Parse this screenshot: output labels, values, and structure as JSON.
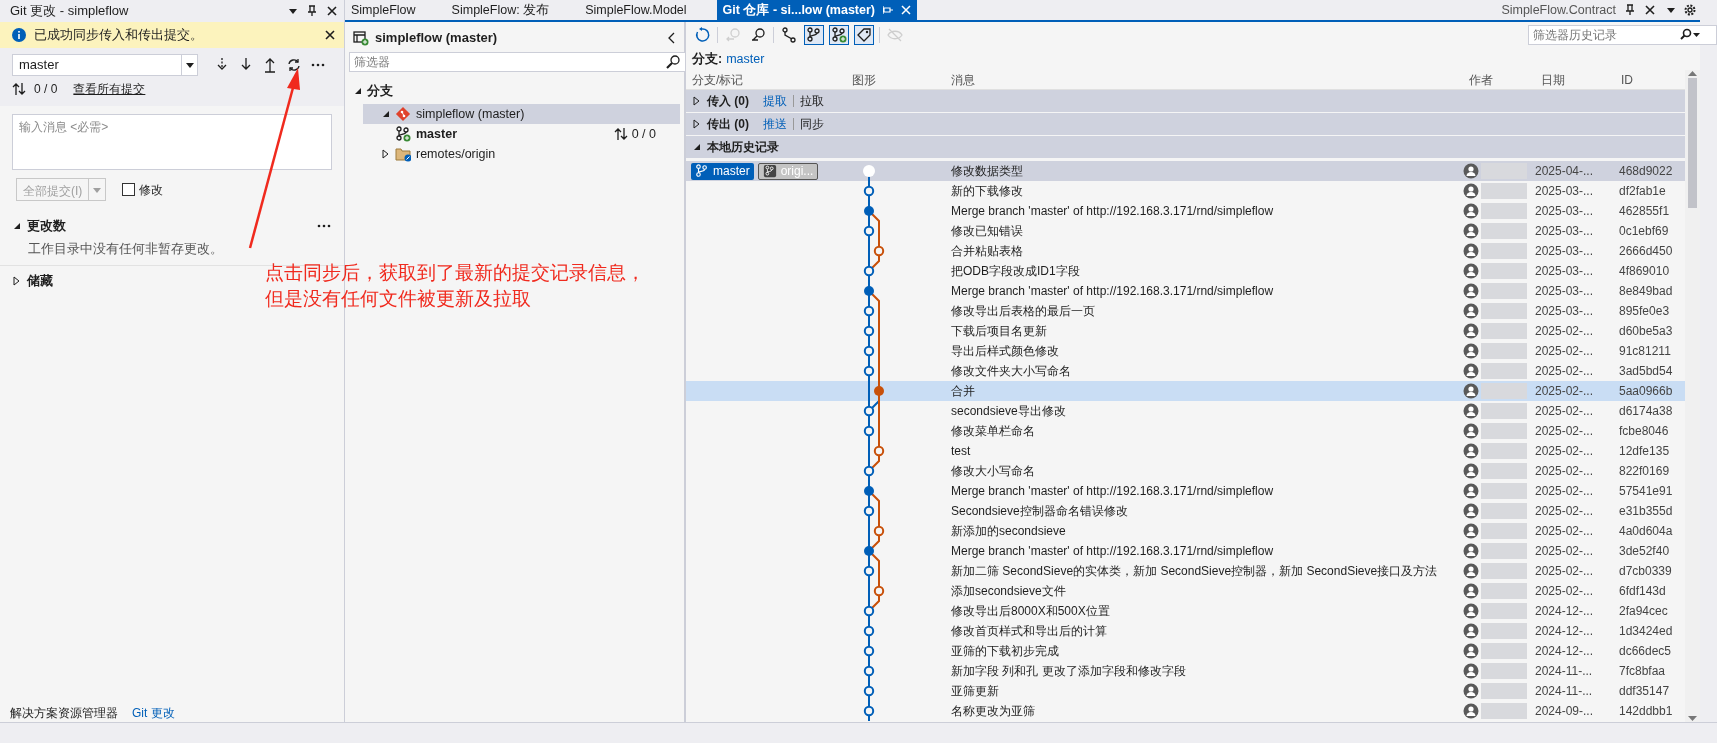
{
  "git_changes_panel": {
    "title": "Git 更改 - simpleflow",
    "notification": {
      "text": "已成功同步传入和传出提交。"
    },
    "branch_combo": {
      "value": "master"
    },
    "sync_status": "0 / 0",
    "view_all_link": "查看所有提交",
    "message_box": {
      "placeholder": "输入消息 <必需>"
    },
    "commit_button": {
      "label": "全部提交(I)",
      "disabled": true
    },
    "amend_checkbox": {
      "label": "修改",
      "checked": false
    },
    "sections": [
      {
        "title": "更改数",
        "expanded": true,
        "text": "工作目录中没有任何非暂存更改。"
      },
      {
        "title": "储藏",
        "expanded": false
      }
    ]
  },
  "bottom_tabs": [
    {
      "label": "解决方案资源管理器",
      "selected": false
    },
    {
      "label": "Git 更改",
      "selected": true
    }
  ],
  "document_tabs": [
    {
      "label": "SimpleFlow",
      "selected": false
    },
    {
      "label": "SimpleFlow: 发布",
      "selected": false
    },
    {
      "label": "SimpleFlow.Model",
      "selected": false
    },
    {
      "label": "Git 仓库 - si...low (master)",
      "selected": true
    }
  ],
  "pinned_tab": {
    "label": "SimpleFlow.Contract"
  },
  "branches_panel": {
    "title": "simpleflow (master)",
    "filter": {
      "placeholder": "筛选器"
    },
    "tree": [
      {
        "label": "分支",
        "kind": "group",
        "expanded": true,
        "selected": false,
        "children": [
          {
            "label": "simpleflow (master)",
            "kind": "repo",
            "expanded": true,
            "selected": true,
            "children": [
              {
                "label": "master",
                "kind": "branch",
                "selected": false,
                "status": "0 / 0"
              }
            ]
          },
          {
            "label": "remotes/origin",
            "kind": "remote",
            "expanded": false,
            "selected": false
          }
        ]
      }
    ]
  },
  "history_panel": {
    "filter": {
      "placeholder": "筛选器历史记录"
    },
    "toolbar": [
      {
        "kind": "refresh",
        "disabled": false,
        "on": false
      },
      {
        "kind": "compare",
        "disabled": true,
        "on": false
      },
      {
        "kind": "search-commit",
        "disabled": false,
        "on": false
      },
      {
        "kind": "graph",
        "disabled": false,
        "on": false
      },
      {
        "kind": "local-branches",
        "disabled": false,
        "on": true
      },
      {
        "kind": "remote-branches",
        "disabled": false,
        "on": true
      },
      {
        "kind": "tags",
        "disabled": false,
        "on": true
      },
      {
        "kind": "hide",
        "disabled": true,
        "on": false
      }
    ],
    "branch_label": "分支:",
    "branch": "master",
    "columns": [
      "分支/标记",
      "图形",
      "消息",
      "作者",
      "日期",
      "ID"
    ],
    "groups": [
      {
        "label": "传入 (0)",
        "expanded": false,
        "links": [
          "提取",
          "拉取"
        ]
      },
      {
        "label": "传出 (0)",
        "expanded": false,
        "links": [
          "推送",
          "同步"
        ]
      },
      {
        "label": "本地历史记录",
        "expanded": true
      }
    ],
    "commits": [
      {
        "refs": [
          {
            "label": "master",
            "kind": "local"
          },
          {
            "label": "origi...",
            "kind": "remote"
          }
        ],
        "side": false,
        "kind": "head",
        "message": "修改数据类型",
        "date": "2025-04-...",
        "id": "468d9022",
        "selected": false,
        "current": true
      },
      {
        "side": false,
        "kind": "commit",
        "message": "新的下载修改",
        "date": "2025-03-...",
        "id": "df2fab1e",
        "selected": false,
        "current": false
      },
      {
        "side": false,
        "kind": "merge",
        "message": "Merge branch 'master' of http://192.168.3.171/rnd/simpleflow",
        "date": "2025-03-...",
        "id": "462855f1",
        "selected": false,
        "current": false
      },
      {
        "side": false,
        "kind": "commit",
        "message": "修改已知错误",
        "date": "2025-03-...",
        "id": "0c1ebf69",
        "selected": false,
        "current": false
      },
      {
        "side": true,
        "kind": "commit",
        "message": "合并粘贴表格",
        "date": "2025-03-...",
        "id": "2666d450",
        "selected": false,
        "current": false
      },
      {
        "side": false,
        "kind": "commit",
        "message": "把ODB字段改成ID1字段",
        "date": "2025-03-...",
        "id": "4f869010",
        "selected": false,
        "current": false
      },
      {
        "side": false,
        "kind": "merge",
        "message": "Merge branch 'master' of http://192.168.3.171/rnd/simpleflow",
        "date": "2025-03-...",
        "id": "8e849bad",
        "selected": false,
        "current": false
      },
      {
        "side": false,
        "kind": "commit",
        "message": "修改导出后表格的最后一页",
        "date": "2025-03-...",
        "id": "895fe0e3",
        "selected": false,
        "current": false
      },
      {
        "side": false,
        "kind": "commit",
        "message": "下载后项目名更新",
        "date": "2025-02-...",
        "id": "d60be5a3",
        "selected": false,
        "current": false
      },
      {
        "side": false,
        "kind": "commit",
        "message": "导出后样式颜色修改",
        "date": "2025-02-...",
        "id": "91c81211",
        "selected": false,
        "current": false
      },
      {
        "side": false,
        "kind": "commit",
        "message": "修改文件夹大小写命名",
        "date": "2025-02-...",
        "id": "3ad5bd54",
        "selected": false,
        "current": false
      },
      {
        "side": true,
        "kind": "merge",
        "message": "合并",
        "date": "2025-02-...",
        "id": "5aa0966b",
        "selected": true,
        "current": false
      },
      {
        "side": false,
        "kind": "commit",
        "message": "secondsieve导出修改",
        "date": "2025-02-...",
        "id": "d6174a38",
        "selected": false,
        "current": false
      },
      {
        "side": false,
        "kind": "commit",
        "message": "修改菜单栏命名",
        "date": "2025-02-...",
        "id": "fcbe8046",
        "selected": false,
        "current": false
      },
      {
        "side": true,
        "kind": "commit",
        "message": "test",
        "date": "2025-02-...",
        "id": "12dfe135",
        "selected": false,
        "current": false
      },
      {
        "side": false,
        "kind": "commit",
        "message": "修改大小写命名",
        "date": "2025-02-...",
        "id": "822f0169",
        "selected": false,
        "current": false
      },
      {
        "side": false,
        "kind": "merge",
        "message": "Merge branch 'master' of http://192.168.3.171/rnd/simpleflow",
        "date": "2025-02-...",
        "id": "57541e91",
        "selected": false,
        "current": false
      },
      {
        "side": false,
        "kind": "commit",
        "message": "Secondsieve控制器命名错误修改",
        "date": "2025-02-...",
        "id": "e31b355d",
        "selected": false,
        "current": false
      },
      {
        "side": true,
        "kind": "commit",
        "message": "新添加的secondsieve",
        "date": "2025-02-...",
        "id": "4a0d604a",
        "selected": false,
        "current": false
      },
      {
        "side": false,
        "kind": "merge",
        "message": "Merge branch 'master' of http://192.168.3.171/rnd/simpleflow",
        "date": "2025-02-...",
        "id": "3de52f40",
        "selected": false,
        "current": false
      },
      {
        "side": false,
        "kind": "commit",
        "message": "新加二筛 SecondSieve的实体类，新加 SecondSieve控制器，新加 SecondSieve接口及方法",
        "date": "2025-02-...",
        "id": "d7cb0339",
        "selected": false,
        "current": false
      },
      {
        "side": true,
        "kind": "commit",
        "message": "添加secondsieve文件",
        "date": "2025-02-...",
        "id": "6fdf143d",
        "selected": false,
        "current": false
      },
      {
        "side": false,
        "kind": "commit",
        "message": "修改导出后8000X和500X位置",
        "date": "2024-12-...",
        "id": "2fa94cec",
        "selected": false,
        "current": false
      },
      {
        "side": false,
        "kind": "commit",
        "message": "修改首页样式和导出后的计算",
        "date": "2024-12-...",
        "id": "1d3424ed",
        "selected": false,
        "current": false
      },
      {
        "side": false,
        "kind": "commit",
        "message": "亚筛的下载初步完成",
        "date": "2024-12-...",
        "id": "dc66dec5",
        "selected": false,
        "current": false
      },
      {
        "side": false,
        "kind": "commit",
        "message": "新加字段 列和孔 更改了添加字段和修改字段",
        "date": "2024-11-...",
        "id": "7fc8bfaa",
        "selected": false,
        "current": false
      },
      {
        "side": false,
        "kind": "commit",
        "message": "亚筛更新",
        "date": "2024-11-...",
        "id": "ddf35147",
        "selected": false,
        "current": false
      },
      {
        "side": false,
        "kind": "commit",
        "message": "名称更改为亚筛",
        "date": "2024-09-...",
        "id": "142ddbb1",
        "selected": false,
        "current": false
      }
    ]
  },
  "annotation": {
    "lines": [
      "点击同步后，获取到了最新的提交记录信息，",
      "但是没有任何文件被更新及拉取"
    ]
  }
}
